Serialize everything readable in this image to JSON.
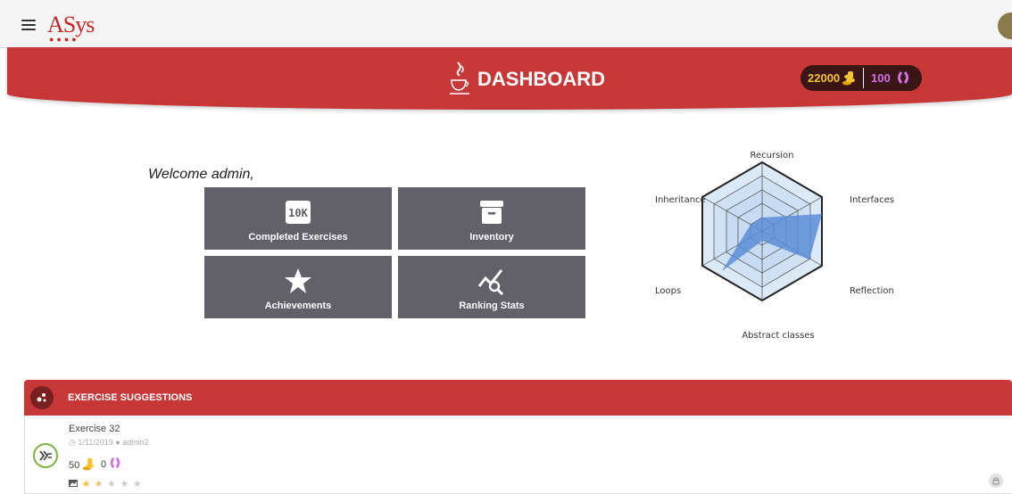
{
  "app": {
    "logo": "ASys"
  },
  "header": {
    "title": "DASHBOARD",
    "gold": "22000",
    "purple": "100"
  },
  "welcome": "Welcome admin,",
  "tiles": [
    {
      "label": "Completed Exercises",
      "icon": "10k-icon"
    },
    {
      "label": "Inventory",
      "icon": "archive-icon"
    },
    {
      "label": "Achievements",
      "icon": "star-icon"
    },
    {
      "label": "Ranking Stats",
      "icon": "chart-search-icon"
    }
  ],
  "radar": {
    "axes": [
      "Recursion",
      "Interfaces",
      "Reflection",
      "Abstract classes",
      "Loops",
      "Inheritance"
    ]
  },
  "suggestions": {
    "title": "EXERCISE SUGGESTIONS",
    "items": [
      {
        "title": "Exercise 32",
        "date": "1/11/2019",
        "author": "admin2",
        "gold": "50",
        "purple": "0",
        "rating": 1.5
      }
    ]
  },
  "colors": {
    "primary": "#c83737",
    "tile": "#626069",
    "gold": "#f4c430",
    "purple": "#d070e0",
    "radarFill": "#5b8dd6"
  }
}
